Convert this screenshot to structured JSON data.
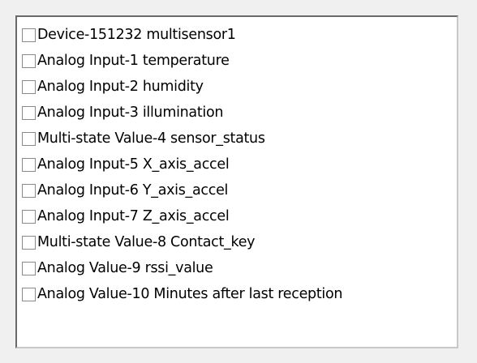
{
  "checklist": {
    "items": [
      {
        "label": "Device-151232 multisensor1",
        "checked": false
      },
      {
        "label": "Analog Input-1 temperature",
        "checked": false
      },
      {
        "label": "Analog Input-2 humidity",
        "checked": false
      },
      {
        "label": "Analog Input-3 illumination",
        "checked": false
      },
      {
        "label": "Multi-state Value-4 sensor_status",
        "checked": false
      },
      {
        "label": "Analog Input-5 X_axis_accel",
        "checked": false
      },
      {
        "label": "Analog Input-6 Y_axis_accel",
        "checked": false
      },
      {
        "label": "Analog Input-7 Z_axis_accel",
        "checked": false
      },
      {
        "label": "Multi-state Value-8 Contact_key",
        "checked": false
      },
      {
        "label": "Analog Value-9 rssi_value",
        "checked": false
      },
      {
        "label": "Analog Value-10 Minutes after last reception",
        "checked": false
      }
    ]
  }
}
